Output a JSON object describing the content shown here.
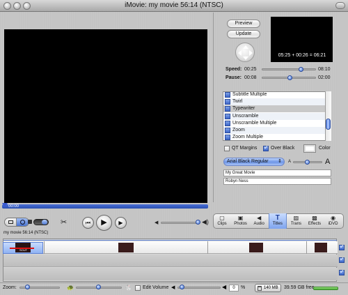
{
  "window": {
    "title": "iMovie: my movie  56:14 (NTSC)"
  },
  "monitor": {
    "playhead_time": "00:00",
    "movie_label": "my movie  56:14 (NTSC)"
  },
  "titles_panel": {
    "preview_label": "Preview",
    "update_label": "Update",
    "preview_times": "05:25  +  00:26  =  06:21",
    "speed": {
      "label": "Speed:",
      "value": "00:25",
      "max": "08:10",
      "level": 0.72
    },
    "pause": {
      "label": "Pause:",
      "value": "00:08",
      "max": "02:00",
      "level": 0.5
    },
    "list_items": [
      "Subtitle Multiple",
      "Twirl",
      "Typewriter",
      "Unscramble",
      "Unscramble Multiple",
      "Zoom",
      "Zoom Multiple"
    ],
    "selected_item": "Typewriter",
    "qt_margins": {
      "label": "QT Margins",
      "checked": false
    },
    "over_black": {
      "label": "Over Black",
      "checked": true
    },
    "color_label": "Color",
    "font_select": "Arial Black Regular",
    "font_size_small": "A",
    "font_size_large": "A",
    "font_size_level": 0.45,
    "text_line_1": "My Great Movie",
    "text_line_2": "Robyn Ness"
  },
  "tabs": [
    {
      "label": "Clips",
      "icon": "clips-icon"
    },
    {
      "label": "Photos",
      "icon": "photos-icon"
    },
    {
      "label": "Audio",
      "icon": "audio-icon"
    },
    {
      "label": "Titles",
      "icon": "titles-icon"
    },
    {
      "label": "Trans",
      "icon": "transitions-icon"
    },
    {
      "label": "Effects",
      "icon": "effects-icon"
    },
    {
      "label": "iDVD",
      "icon": "idvd-icon"
    }
  ],
  "selected_tab": "Titles",
  "timeline": {
    "clip_title_text": "SOUT",
    "tracks_checked": [
      true,
      true,
      true
    ]
  },
  "bottom_bar": {
    "zoom_label": "Zoom:",
    "edit_volume_label": "Edit Volume",
    "edit_volume_checked": false,
    "volume_percent": "0",
    "percent_sign": "%",
    "trash_label": "140 MB",
    "free_space": "39.59 GB free"
  },
  "colors": {
    "accent_blue": "#3b6fd4",
    "monitor_black": "#000000",
    "free_green": "#3fa82c"
  }
}
